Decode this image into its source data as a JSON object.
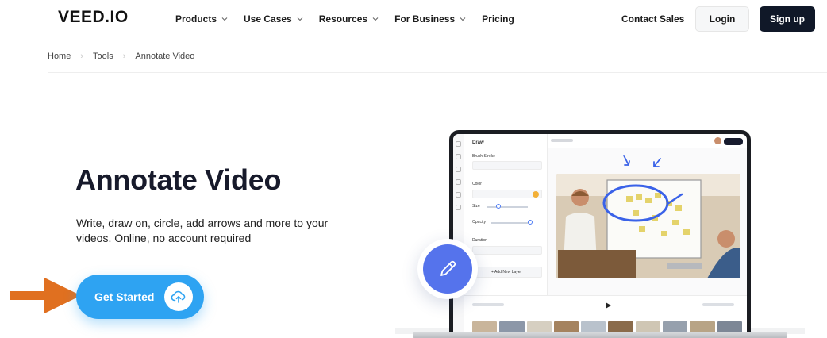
{
  "header": {
    "logo": "VEED.IO",
    "nav": [
      {
        "label": "Products",
        "has_dropdown": true
      },
      {
        "label": "Use Cases",
        "has_dropdown": true
      },
      {
        "label": "Resources",
        "has_dropdown": true
      },
      {
        "label": "For Business",
        "has_dropdown": true
      },
      {
        "label": "Pricing",
        "has_dropdown": false
      }
    ],
    "contact_sales": "Contact Sales",
    "login": "Login",
    "signup": "Sign up"
  },
  "breadcrumb": [
    "Home",
    "Tools",
    "Annotate Video"
  ],
  "hero": {
    "title": "Annotate Video",
    "subtitle": "Write, draw on, circle, add arrows and more to your videos. Online, no account required",
    "cta_label": "Get Started"
  },
  "editor_mockup": {
    "panel_title": "Draw",
    "brush_label": "Brush Stroke",
    "color_label": "Color",
    "size_label": "Size",
    "opacity_label": "Opacity",
    "duration_label": "Duration",
    "add_layer_label": "+ Add New Layer"
  },
  "colors": {
    "cta": "#2ea3f2",
    "signup_bg": "#101828",
    "arrow": "#e07020",
    "pencil_badge": "#5573ec",
    "title": "#171a2b"
  },
  "icons": {
    "cta": "upload-cloud-icon",
    "badge": "pencil-icon",
    "nav_dropdown": "chevron-down-icon",
    "pointer": "arrow-right-icon"
  }
}
